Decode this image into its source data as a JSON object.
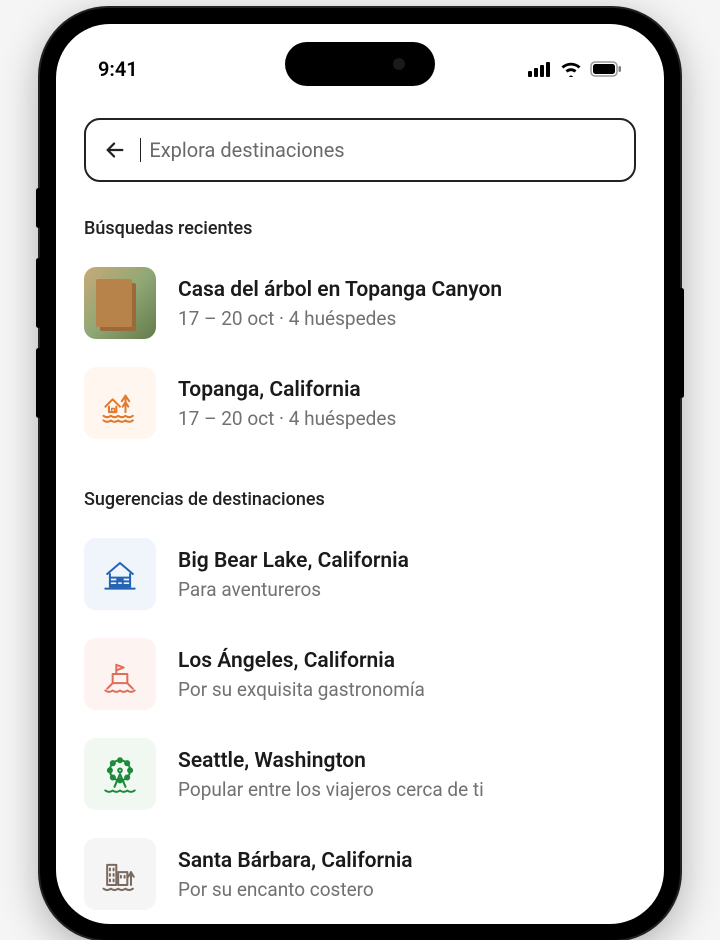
{
  "status": {
    "time": "9:41"
  },
  "search": {
    "placeholder": "Explora destinaciones"
  },
  "sections": {
    "recent": {
      "title": "Búsquedas recientes",
      "items": [
        {
          "title": "Casa del árbol en Topanga Canyon",
          "sub": "17 – 20 oct · 4 huéspedes"
        },
        {
          "title": "Topanga, California",
          "sub": "17 – 20 oct · 4 huéspedes"
        }
      ]
    },
    "suggestions": {
      "title": "Sugerencias de destinaciones",
      "items": [
        {
          "title": "Big Bear Lake, California",
          "sub": "Para aventureros"
        },
        {
          "title": "Los Ángeles, California",
          "sub": "Por su exquisita gastronomía"
        },
        {
          "title": "Seattle, Washington",
          "sub": "Popular entre los viajeros cerca de ti"
        },
        {
          "title": "Santa Bárbara, California",
          "sub": "Por su encanto costero"
        }
      ]
    }
  },
  "icons": {
    "orange": "#e07a2f",
    "blue": "#2563b5",
    "red": "#e06c5a",
    "green": "#1a8a3a",
    "gray": "#7a6a5f"
  }
}
